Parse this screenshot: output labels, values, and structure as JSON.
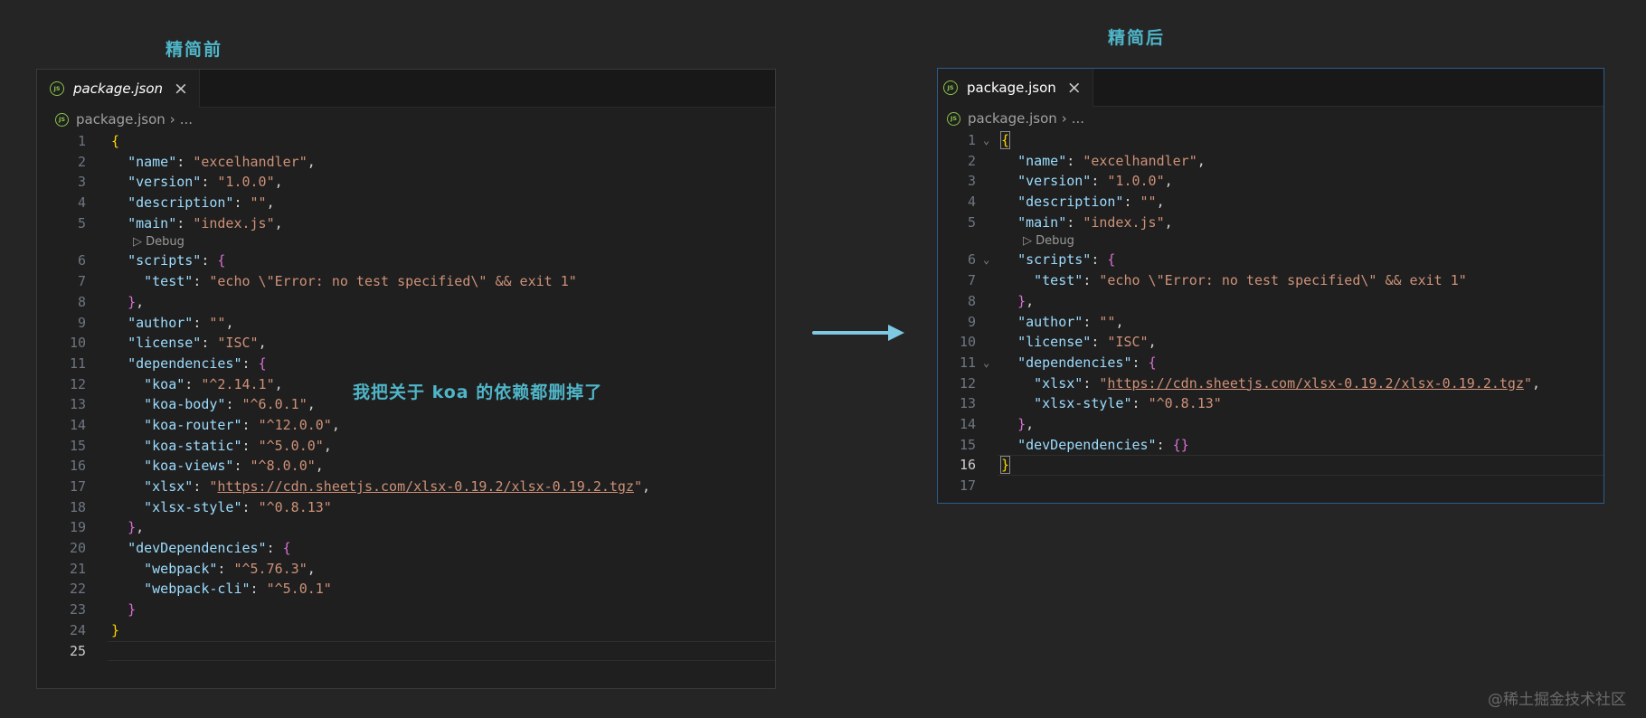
{
  "before": {
    "caption": "精简前",
    "tab_label": "package.json",
    "tab_icon": "JS",
    "breadcrumb_file": "package.json",
    "breadcrumb_more": "...",
    "codelens": "Debug",
    "lines": [
      [
        "1",
        "{"
      ],
      [
        "2",
        "  \"name\": \"excelhandler\","
      ],
      [
        "3",
        "  \"version\": \"1.0.0\","
      ],
      [
        "4",
        "  \"description\": \"\","
      ],
      [
        "5",
        "  \"main\": \"index.js\","
      ],
      [
        "6",
        "  \"scripts\": {"
      ],
      [
        "7",
        "    \"test\": \"echo \\\"Error: no test specified\\\" && exit 1\""
      ],
      [
        "8",
        "  },"
      ],
      [
        "9",
        "  \"author\": \"\","
      ],
      [
        "10",
        "  \"license\": \"ISC\","
      ],
      [
        "11",
        "  \"dependencies\": {"
      ],
      [
        "12",
        "    \"koa\": \"^2.14.1\","
      ],
      [
        "13",
        "    \"koa-body\": \"^6.0.1\","
      ],
      [
        "14",
        "    \"koa-router\": \"^12.0.0\","
      ],
      [
        "15",
        "    \"koa-static\": \"^5.0.0\","
      ],
      [
        "16",
        "    \"koa-views\": \"^8.0.0\","
      ],
      [
        "17",
        "    \"xlsx\": \"https://cdn.sheetjs.com/xlsx-0.19.2/xlsx-0.19.2.tgz\","
      ],
      [
        "18",
        "    \"xlsx-style\": \"^0.8.13\""
      ],
      [
        "19",
        "  },"
      ],
      [
        "20",
        "  \"devDependencies\": {"
      ],
      [
        "21",
        "    \"webpack\": \"^5.76.3\","
      ],
      [
        "22",
        "    \"webpack-cli\": \"^5.0.1\""
      ],
      [
        "23",
        "  }"
      ],
      [
        "24",
        "}"
      ],
      [
        "25",
        ""
      ]
    ]
  },
  "after": {
    "caption": "精简后",
    "tab_label": "package.json",
    "tab_icon": "JS",
    "breadcrumb_file": "package.json",
    "breadcrumb_more": "...",
    "codelens": "Debug",
    "lines": [
      [
        "1",
        "{"
      ],
      [
        "2",
        "  \"name\": \"excelhandler\","
      ],
      [
        "3",
        "  \"version\": \"1.0.0\","
      ],
      [
        "4",
        "  \"description\": \"\","
      ],
      [
        "5",
        "  \"main\": \"index.js\","
      ],
      [
        "6",
        "  \"scripts\": {"
      ],
      [
        "7",
        "    \"test\": \"echo \\\"Error: no test specified\\\" && exit 1\""
      ],
      [
        "8",
        "  },"
      ],
      [
        "9",
        "  \"author\": \"\","
      ],
      [
        "10",
        "  \"license\": \"ISC\","
      ],
      [
        "11",
        "  \"dependencies\": {"
      ],
      [
        "12",
        "    \"xlsx\": \"https://cdn.sheetjs.com/xlsx-0.19.2/xlsx-0.19.2.tgz\","
      ],
      [
        "13",
        "    \"xlsx-style\": \"^0.8.13\""
      ],
      [
        "14",
        "  },"
      ],
      [
        "15",
        "  \"devDependencies\": {}"
      ],
      [
        "16",
        "}"
      ],
      [
        "17",
        ""
      ]
    ]
  },
  "note": "我把关于 koa 的依赖都删掉了",
  "watermark": "@稀土掘金技术社区",
  "colors": {
    "accent": "#4fb6c9",
    "key": "#9cdcfe",
    "string": "#ce9178",
    "arrow": "#7ec8e3"
  }
}
